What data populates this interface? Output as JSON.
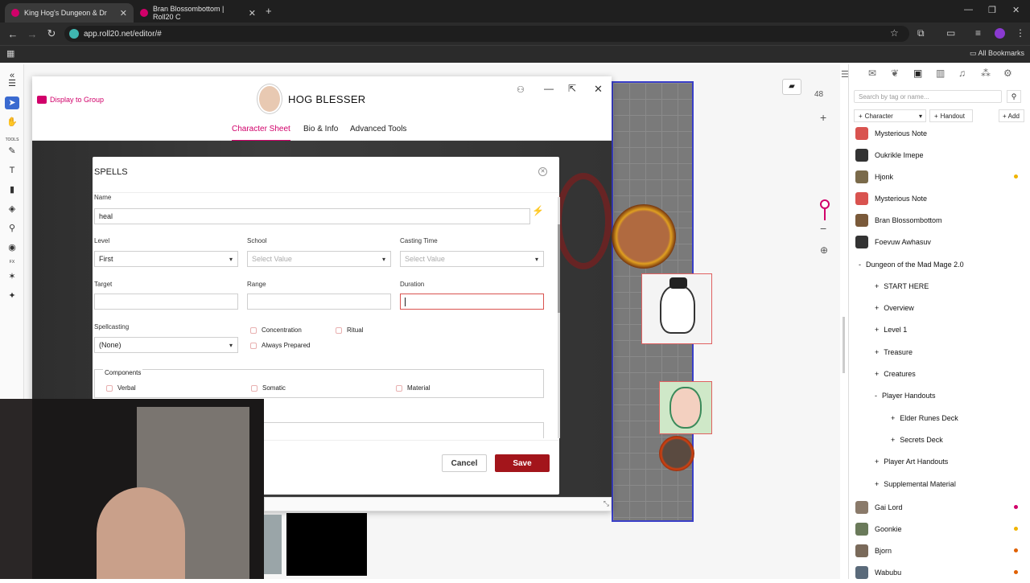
{
  "browser": {
    "tabs": [
      {
        "label": "King Hog's Dungeon & Dr"
      },
      {
        "label": "Bran Blossombottom | Roll20 C"
      }
    ],
    "url": "app.roll20.net/editor/#",
    "bookmarks_label": "All Bookmarks"
  },
  "sheet": {
    "display_group": "Display to Group",
    "character_name": "HOG BLESSER",
    "tabs": [
      {
        "label": "Character Sheet",
        "active": true
      },
      {
        "label": "Bio & Info"
      },
      {
        "label": "Advanced Tools"
      }
    ]
  },
  "spells_modal": {
    "title": "SPELLS",
    "name_label": "Name",
    "name_value": "heal",
    "level_label": "Level",
    "level_value": "First",
    "school_label": "School",
    "school_placeholder": "Select Value",
    "casting_label": "Casting Time",
    "casting_placeholder": "Select Value",
    "target_label": "Target",
    "target_value": "",
    "range_label": "Range",
    "range_value": "",
    "duration_label": "Duration",
    "duration_value": "",
    "spellcasting_label": "Spellcasting",
    "spellcasting_value": "(None)",
    "concentration": "Concentration",
    "ritual": "Ritual",
    "always_prepared": "Always Prepared",
    "components_label": "Components",
    "verbal": "Verbal",
    "somatic": "Somatic",
    "material": "Material",
    "cancel": "Cancel",
    "save": "Save"
  },
  "map": {
    "zoom": "48"
  },
  "journal": {
    "search_placeholder": "Search by tag or name...",
    "character_btn": "Character",
    "handout_btn": "Handout",
    "add_btn": "Add",
    "items": [
      {
        "label": "Mysterious Note",
        "color": "#d9534f"
      },
      {
        "label": "Oukrikle Imepe",
        "color": "#333"
      },
      {
        "label": "Hjonk",
        "color": "#7a6a4a",
        "dot": "#f0b400"
      },
      {
        "label": "Mysterious Note",
        "color": "#d9534f"
      },
      {
        "label": "Bran Blossombottom",
        "color": "#7a5a3a"
      },
      {
        "label": "Foevuw Awhasuv",
        "color": "#333"
      }
    ],
    "folders": [
      {
        "label": "Dungeon of the Mad Mage 2.0",
        "sign": "-",
        "indent": 0
      },
      {
        "label": "START HERE",
        "sign": "+",
        "indent": 1
      },
      {
        "label": "Overview",
        "sign": "+",
        "indent": 1
      },
      {
        "label": "Level 1",
        "sign": "+",
        "indent": 1
      },
      {
        "label": "Treasure",
        "sign": "+",
        "indent": 1
      },
      {
        "label": "Creatures",
        "sign": "+",
        "indent": 1
      },
      {
        "label": "Player Handouts",
        "sign": "-",
        "indent": 1
      },
      {
        "label": "Elder Runes Deck",
        "sign": "+",
        "indent": 2
      },
      {
        "label": "Secrets Deck",
        "sign": "+",
        "indent": 2
      },
      {
        "label": "Player Art Handouts",
        "sign": "+",
        "indent": 1
      },
      {
        "label": "Supplemental Material",
        "sign": "+",
        "indent": 1
      }
    ],
    "bottom_items": [
      {
        "label": "Gai Lord",
        "color": "#8a7a6a",
        "dot": "#d1006a"
      },
      {
        "label": "Goonkie",
        "color": "#6a7a5a",
        "dot": "#f0b400"
      },
      {
        "label": "Bjorn",
        "color": "#7a6a5a",
        "dot": "#e06000"
      },
      {
        "label": "Wabubu",
        "color": "#5a6a7a",
        "dot": "#e06000"
      }
    ]
  }
}
